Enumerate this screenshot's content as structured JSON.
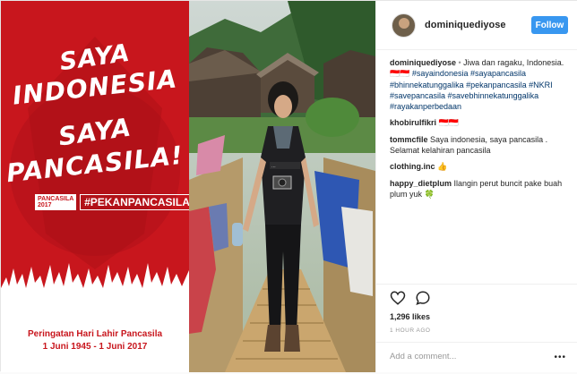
{
  "poster": {
    "headline_line1": "SAYA",
    "headline_line2": "INDONESIA",
    "headline_line3": "SAYA",
    "headline_line4": "PANCASILA!",
    "year_badge": "PANCASILA 2017",
    "hashtag": "#PEKANPANCASILA",
    "caption_line1": "Peringatan Hari Lahir Pancasila",
    "caption_line2": "1 Juni 1945 - 1 Juni 2017",
    "red": "#c8161d"
  },
  "header": {
    "username": "dominiquediyose",
    "follow_label": "Follow",
    "follow_color": "#3897f0"
  },
  "comments": [
    {
      "user": "dominiquediyose",
      "bullet": " •",
      "text": " Jiwa dan ragaku, Indonesia.",
      "tags": "🇮🇩🇮🇩 #sayaindonesia #sayapancasila #bhinnekatunggalika #pekanpancasila #NKRI #savepancasila #savebhinnekatunggalika #rayakanperbedaan"
    },
    {
      "user": "khobirulfikri",
      "text": " 🇮🇩🇮🇩"
    },
    {
      "user": "tommcfile",
      "text": " Saya indonesia, saya pancasila . Selamat kelahiran pancasila"
    },
    {
      "user": "clothing.inc",
      "text": " 👍"
    },
    {
      "user": "happy_dietplum",
      "text": " Ilangin perut buncit pake buah plum yuk 🍀"
    }
  ],
  "actions": {
    "likes": "1,296 likes",
    "time": "1 HOUR AGO",
    "add_comment_placeholder": "Add a comment...",
    "more_label": "•••"
  }
}
